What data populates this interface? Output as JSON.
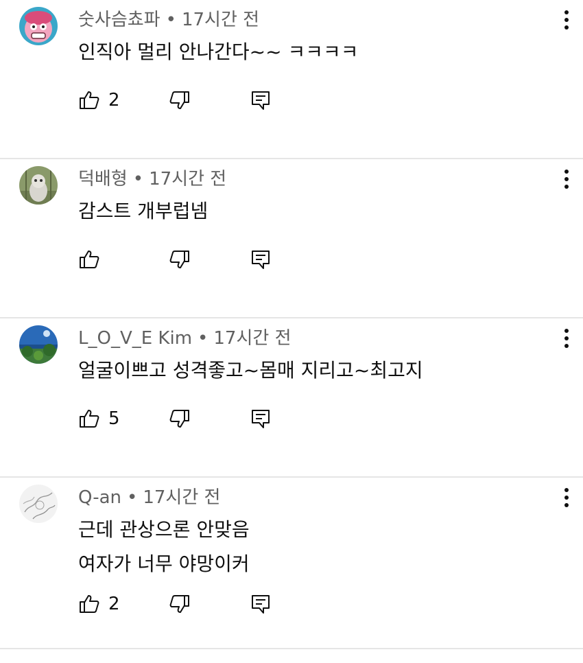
{
  "comments": [
    {
      "author": "숫사슴쵸파",
      "separator": "•",
      "time": "17시간 전",
      "lines": [
        "인직아 멀리 안나간다~~ ㅋㅋㅋㅋ"
      ],
      "likes": "2",
      "avatar_icon": "avatar-pink-character",
      "avatar_colors": [
        "#3aa7c9",
        "#f3a6c0"
      ]
    },
    {
      "author": "덕배형",
      "separator": "•",
      "time": "17시간 전",
      "lines": [
        "감스트 개부럽넴"
      ],
      "likes": "",
      "avatar_icon": "avatar-owl-photo",
      "avatar_colors": [
        "#8a9a6a",
        "#d8d6cf"
      ]
    },
    {
      "author": "L_O_V_E Kim",
      "separator": "•",
      "time": "17시간 전",
      "lines": [
        "얼굴이쁘고 성격좋고~몸매 지리고~최고지"
      ],
      "likes": "5",
      "avatar_icon": "avatar-landscape-photo",
      "avatar_colors": [
        "#2a6ab8",
        "#3e7a3a"
      ]
    },
    {
      "author": "Q-an",
      "separator": "•",
      "time": "17시간 전",
      "lines": [
        "근데 관상으론 안맞음",
        "여자가 너무 야망이커"
      ],
      "likes": "2",
      "avatar_icon": "avatar-sketch",
      "avatar_colors": [
        "#f2f2f2",
        "#9a9a9a"
      ]
    }
  ],
  "icons": {
    "like": "thumbs-up-icon",
    "dislike": "thumbs-down-icon",
    "reply": "reply-icon",
    "menu": "more-vertical-icon"
  }
}
